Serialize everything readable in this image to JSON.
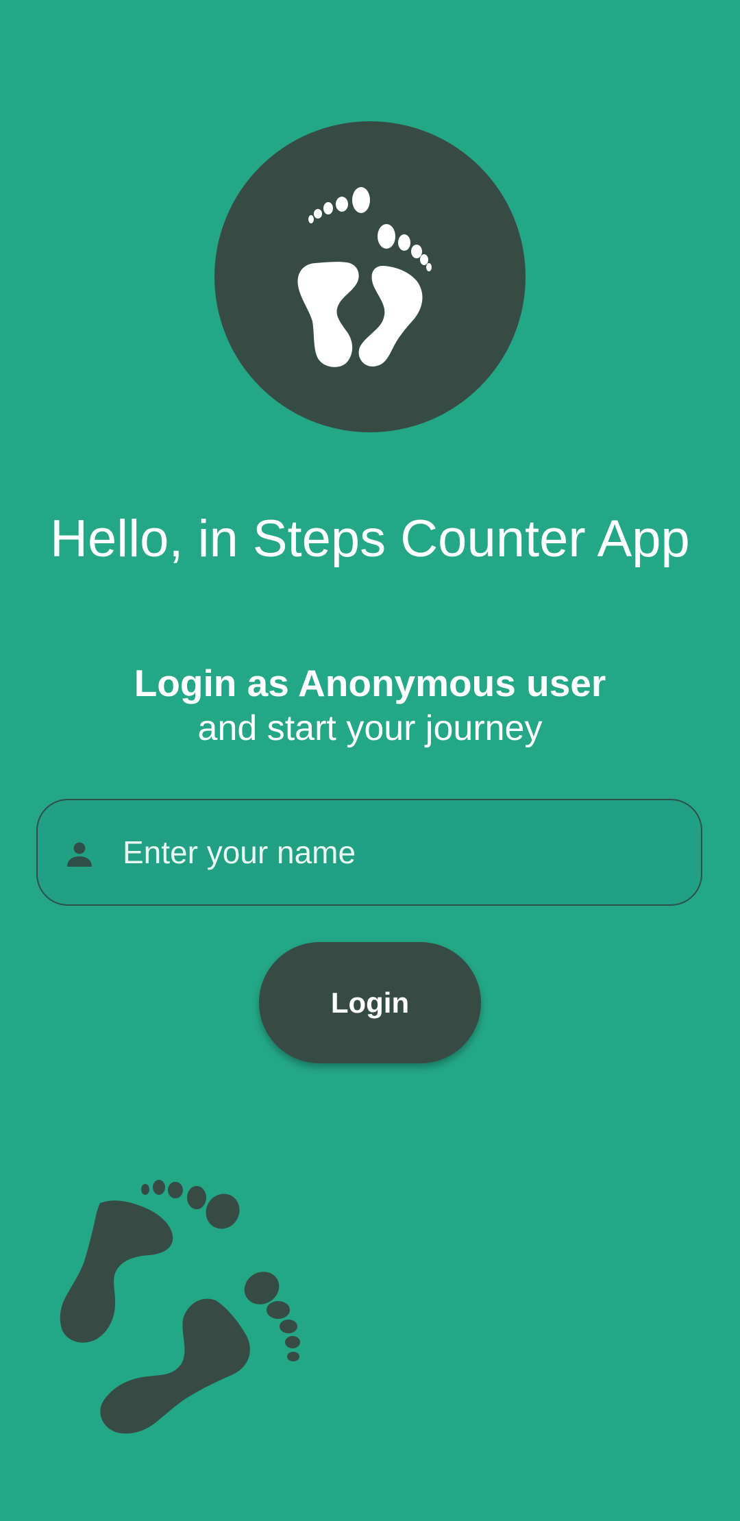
{
  "app": {
    "logo_icon": "footprints-icon",
    "title": "Hello, in Steps Counter App"
  },
  "login": {
    "headline": "Login as Anonymous user",
    "subheadline": "and start your journey",
    "name_field": {
      "icon": "person-icon",
      "placeholder": "Enter your name",
      "value": ""
    },
    "button_label": "Login"
  },
  "decoration": {
    "bottom_icon": "footprints-icon"
  },
  "colors": {
    "background": "#24a786",
    "dark_accent": "#374b45",
    "text": "#ffffff"
  }
}
